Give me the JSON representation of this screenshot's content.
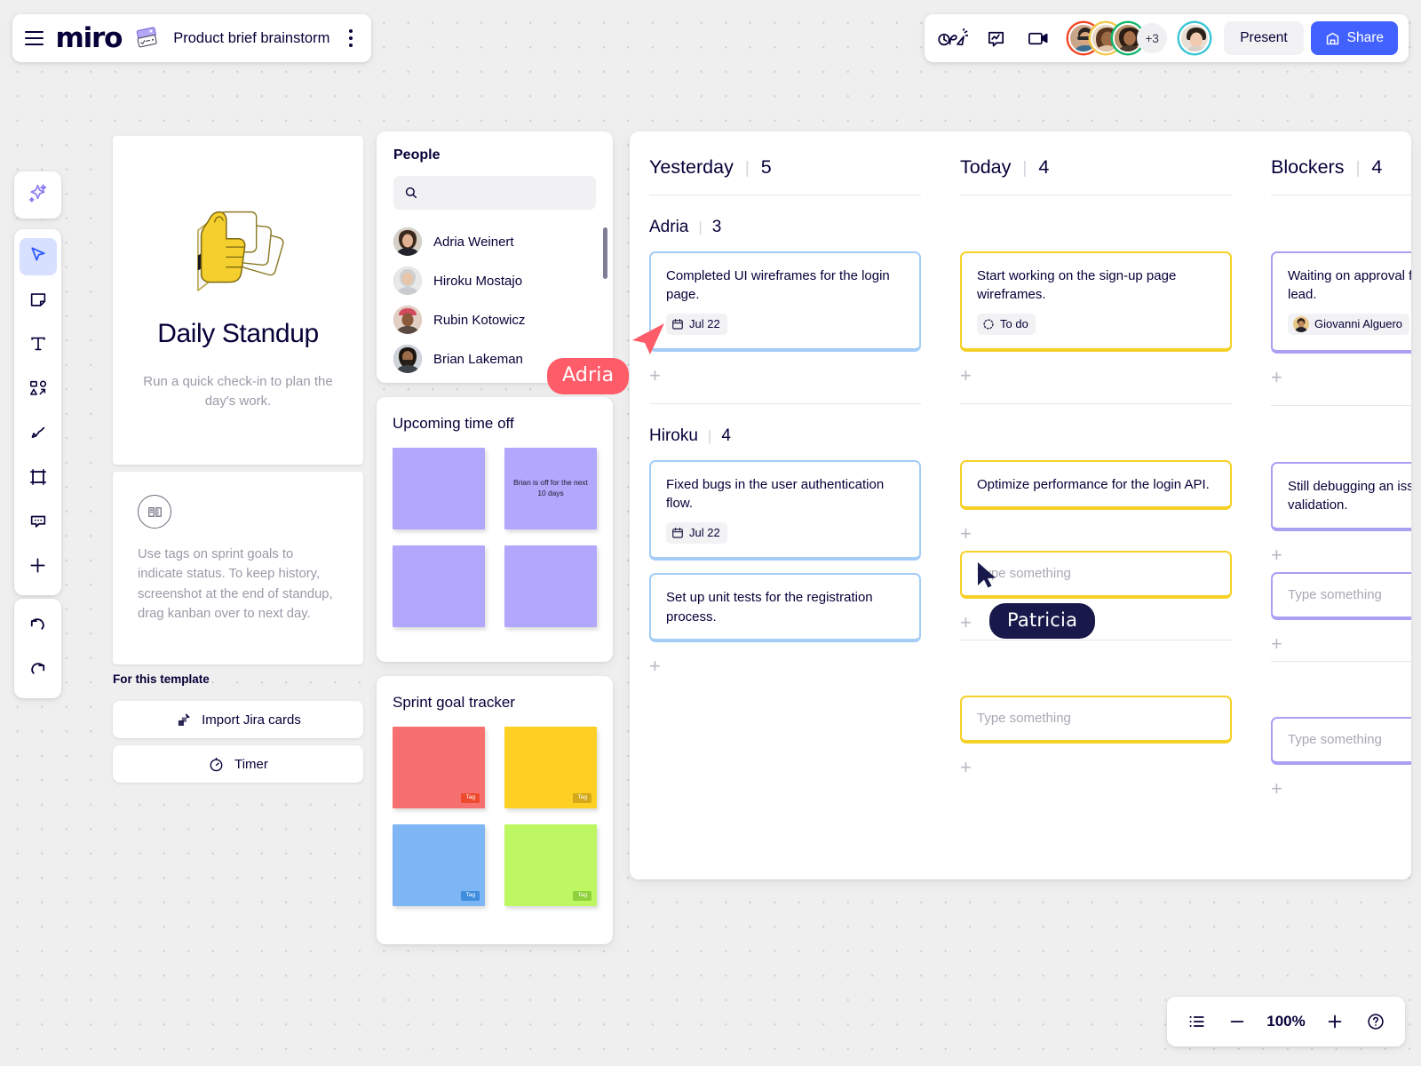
{
  "topbar": {
    "menu_icon": "hamburger-icon",
    "logo": "miro",
    "board_icon": "board-thumbnail-icon",
    "board_title": "Product brief brainstorm",
    "kebab_icon": "more-options-icon",
    "timer_icon": "timer-reaction-icon",
    "comment_icon": "comment-icon",
    "video_icon": "video-call-icon",
    "avatars_overflow": "+3",
    "present_label": "Present",
    "share_label": "Share",
    "share_icon": "share-board-icon",
    "accent_blue": "#4262ff"
  },
  "left_toolbar": {
    "items": [
      {
        "name": "ai-sparkle-tool",
        "icon": "sparkle-icon"
      },
      {
        "name": "select-tool",
        "icon": "cursor-arrow-icon",
        "active": true
      },
      {
        "name": "sticky-note-tool",
        "icon": "sticky-note-icon"
      },
      {
        "name": "text-tool",
        "icon": "text-t-icon"
      },
      {
        "name": "shapes-tool",
        "icon": "shapes-icon"
      },
      {
        "name": "pen-tool",
        "icon": "pen-icon"
      },
      {
        "name": "frame-tool",
        "icon": "frame-icon"
      },
      {
        "name": "comment-tool",
        "icon": "comment-bubble-icon"
      },
      {
        "name": "more-apps-tool",
        "icon": "plus-icon"
      },
      {
        "name": "undo-tool",
        "icon": "undo-arrow-icon"
      },
      {
        "name": "redo-tool",
        "icon": "redo-arrow-icon"
      }
    ]
  },
  "template_card": {
    "illustration": "thumbs-up-with-cards-illustration",
    "title": "Daily Standup",
    "subtitle": "Run a quick check-in to plan the day's work."
  },
  "note_card": {
    "icon": "open-book-icon",
    "text": "Use tags on sprint goals to indicate status. To keep history, screenshot at the end of standup, drag kanban over to next day."
  },
  "for_this_template": {
    "heading": "For this template",
    "buttons": [
      {
        "label": "Import Jira cards",
        "icon": "jira-icon"
      },
      {
        "label": "Timer",
        "icon": "stopwatch-icon"
      }
    ]
  },
  "people_panel": {
    "heading": "People",
    "search_placeholder": "",
    "search_icon": "search-icon",
    "search_value": "",
    "members": [
      {
        "name": "Adria Weinert",
        "ring": "#3bc5d6"
      },
      {
        "name": "Hiroku Mostajo",
        "ring": "#e8912d"
      },
      {
        "name": "Rubin Kotowicz",
        "ring": "#e05a6f"
      },
      {
        "name": "Brian Lakeman",
        "ring": "#6b4de6"
      }
    ]
  },
  "time_off_panel": {
    "heading": "Upcoming time off",
    "color": "#b1a7fc",
    "notes": [
      "",
      "Brian is off for the next 10 days",
      "",
      ""
    ]
  },
  "sprint_panel": {
    "heading": "Sprint goal tracker",
    "notes": [
      {
        "color": "#f77070",
        "tag": "Tag",
        "tag_color": "#ed4a2e"
      },
      {
        "color": "#fdd023",
        "tag": "Tag",
        "tag_color": "#d3a81b"
      },
      {
        "color": "#7db5f5",
        "tag": "Tag",
        "tag_color": "#3f8ede"
      },
      {
        "color": "#bdf761",
        "tag": "Tag",
        "tag_color": "#8ed13a"
      }
    ]
  },
  "kanban": {
    "columns": [
      {
        "title": "Yesterday",
        "count": "5",
        "groups": [
          {
            "name": "Adria",
            "count": "3",
            "cards": [
              {
                "text": "Completed UI wireframes for the login page.",
                "color": "blue",
                "chip": {
                  "type": "date",
                  "icon": "calendar-icon",
                  "label": "Jul 22"
                }
              }
            ],
            "add_label": "+"
          },
          {
            "name": "Hiroku",
            "count": "4",
            "cards": [
              {
                "text": "Fixed bugs in the user authentication flow.",
                "color": "blue",
                "chip": {
                  "type": "date",
                  "icon": "calendar-icon",
                  "label": "Jul 22"
                }
              },
              {
                "text": "Set up unit tests for the registration process.",
                "color": "blue",
                "chip": null
              }
            ],
            "add_label": "+"
          }
        ]
      },
      {
        "title": "Today",
        "count": "4",
        "groups": [
          {
            "name": "",
            "count": "",
            "cards": [
              {
                "text": "Start working on the sign-up page wireframes.",
                "color": "yellow",
                "chip": {
                  "type": "status",
                  "icon": "status-circle-icon",
                  "label": "To do"
                }
              }
            ],
            "add_label": "+"
          },
          {
            "name": "",
            "count": "",
            "cards": [
              {
                "text": "Optimize performance for the login API.",
                "color": "yellow",
                "chip": null
              }
            ],
            "add_label": "+",
            "input_placeholder": "Type something",
            "input_color": "yellow",
            "input_add_label": "+",
            "second_input_placeholder": "Type something",
            "second_add_label": "+"
          }
        ]
      },
      {
        "title": "Blockers",
        "count": "4",
        "groups": [
          {
            "name": "",
            "count": "",
            "cards": [
              {
                "text": "Waiting on approval from the design lead.",
                "color": "purple",
                "chip": {
                  "type": "person",
                  "icon": "avatar-icon",
                  "label": "Giovanni Alguero"
                }
              }
            ],
            "add_label": "+"
          },
          {
            "name": "",
            "count": "",
            "cards": [
              {
                "text": "Still debugging an issue with token validation.",
                "color": "purple",
                "chip": null
              }
            ],
            "add_label": "+",
            "input_placeholder": "Type something",
            "input_color": "purple",
            "input_add_label": "+",
            "second_input_placeholder": "Type something",
            "second_add_label": "+"
          }
        ]
      }
    ]
  },
  "cursors": [
    {
      "name": "Adria",
      "color": "#ff5c6a"
    },
    {
      "name": "Patricia",
      "color": "#18194a"
    }
  ],
  "zoombar": {
    "list_icon": "list-view-icon",
    "minus_label": "—",
    "zoom_level": "100%",
    "plus_label": "+",
    "help_icon": "question-mark-icon"
  }
}
